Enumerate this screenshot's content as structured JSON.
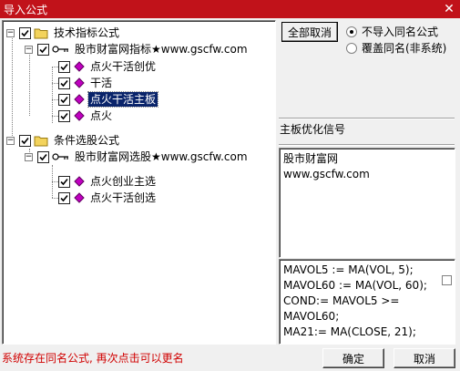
{
  "window": {
    "title": "导入公式",
    "close_glyph": "✕"
  },
  "tree": {
    "nodes": [
      {
        "label": "技术指标公式",
        "kind": "folder",
        "expanded": true,
        "checked": true
      },
      {
        "label": "股市财富网指标★www.gscfw.com",
        "kind": "key",
        "expanded": true,
        "checked": true
      },
      {
        "label": "点火干活创优",
        "kind": "formula",
        "checked": true,
        "selected": false
      },
      {
        "label": "干活",
        "kind": "formula",
        "checked": true,
        "selected": false
      },
      {
        "label": "点火干活主板",
        "kind": "formula",
        "checked": true,
        "selected": true
      },
      {
        "label": "点火",
        "kind": "formula",
        "checked": true,
        "selected": false
      },
      {
        "label": "条件选股公式",
        "kind": "folder",
        "expanded": true,
        "checked": true
      },
      {
        "label": "股市财富网选股★www.gscfw.com",
        "kind": "key",
        "expanded": true,
        "checked": true
      },
      {
        "label": "点火创业主选",
        "kind": "formula",
        "checked": true,
        "selected": false
      },
      {
        "label": "点火干活创选",
        "kind": "formula",
        "checked": true,
        "selected": false
      }
    ]
  },
  "options": {
    "uncheck_all_label": "全部取消",
    "radio_skip_label": "不导入同名公式",
    "radio_overwrite_label": "覆盖同名(非系统)",
    "selected": "skip"
  },
  "description": "主板优化信号",
  "info_lines": [
    "股市财富网",
    "www.gscfw.com"
  ],
  "code_lines": [
    "MAVOL5 := MA(VOL, 5);",
    "MAVOL60 := MA(VOL, 60);",
    "COND:= MAVOL5 >=",
    "MAVOL60;",
    "MA21:= MA(CLOSE, 21);"
  ],
  "status": "系统存在同名公式, 再次点击可以更名",
  "buttons": {
    "ok_label": "确定",
    "cancel_label": "取消"
  },
  "colors": {
    "titlebar": "#c1121a",
    "selection": "#0a246a",
    "status_text": "#d00000",
    "formula_icon": "#c000c0",
    "folder_icon": "#f3d35c"
  }
}
